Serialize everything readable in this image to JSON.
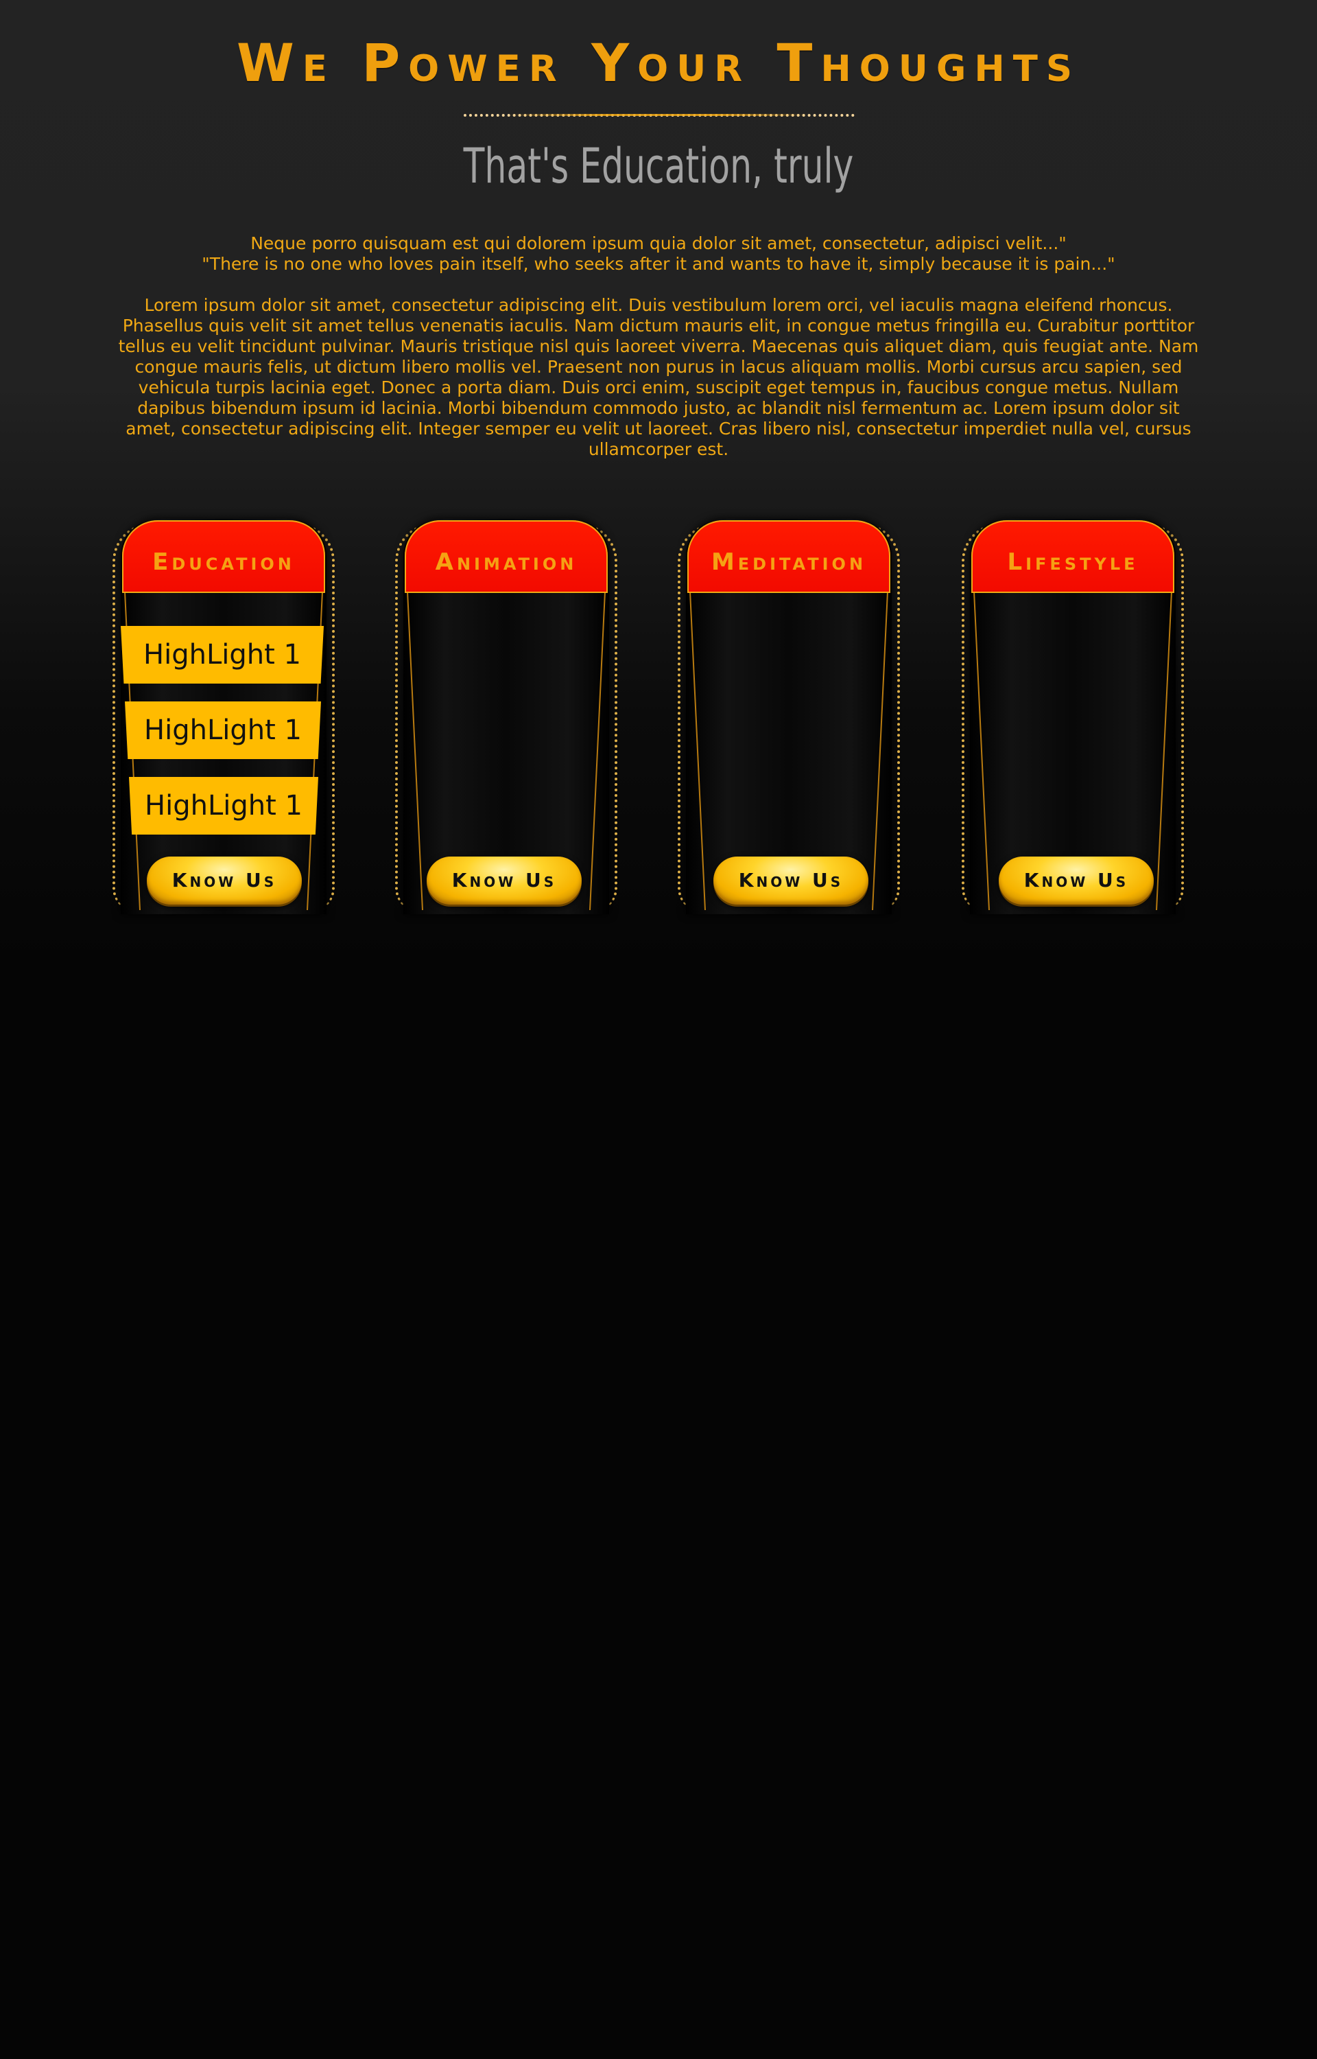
{
  "hero": {
    "headline": "We Power Your Thoughts",
    "subtitle": "That's Education, truly",
    "quote_line_1": "Neque porro quisquam est qui dolorem ipsum quia dolor sit amet, consectetur, adipisci velit...\"",
    "quote_line_2": "\"There is no one who loves pain itself, who seeks after it and wants to have it, simply because it is pain...\"",
    "body": "Lorem ipsum dolor sit amet, consectetur adipiscing elit. Duis vestibulum lorem orci, vel iaculis magna eleifend rhoncus. Phasellus quis velit sit amet tellus venenatis iaculis. Nam dictum mauris elit, in congue metus fringilla eu. Curabitur porttitor tellus eu velit tincidunt pulvinar. Mauris tristique nisl quis laoreet viverra. Maecenas quis aliquet diam, quis feugiat ante. Nam congue mauris felis, ut dictum libero mollis vel. Praesent non purus in lacus aliquam mollis. Morbi cursus arcu sapien, sed vehicula turpis lacinia eget. Donec a porta diam. Duis orci enim, suscipit eget tempus in, faucibus congue metus. Nullam dapibus bibendum ipsum id lacinia. Morbi bibendum commodo justo, ac blandit nisl fermentum ac. Lorem ipsum dolor sit amet, consectetur adipiscing elit. Integer semper eu velit ut laoreet. Cras libero nisl, consectetur imperdiet nulla vel, cursus ullamcorper est."
  },
  "cards": [
    {
      "title": "Education",
      "highlights": [
        "HighLight 1",
        "HighLight 1",
        "HighLight 1"
      ],
      "button": "Know Us"
    },
    {
      "title": "Animation",
      "button": "Know Us"
    },
    {
      "title": "Meditation",
      "button": "Know Us"
    },
    {
      "title": "Lifestyle",
      "button": "Know Us"
    }
  ],
  "colors": {
    "accent": "#f0a814",
    "header_red": "#ff1a00",
    "highlight_yellow": "#ffbb00",
    "background_top": "#232323",
    "background_bottom": "#050505",
    "subtitle_gray": "#a2a2a2"
  }
}
